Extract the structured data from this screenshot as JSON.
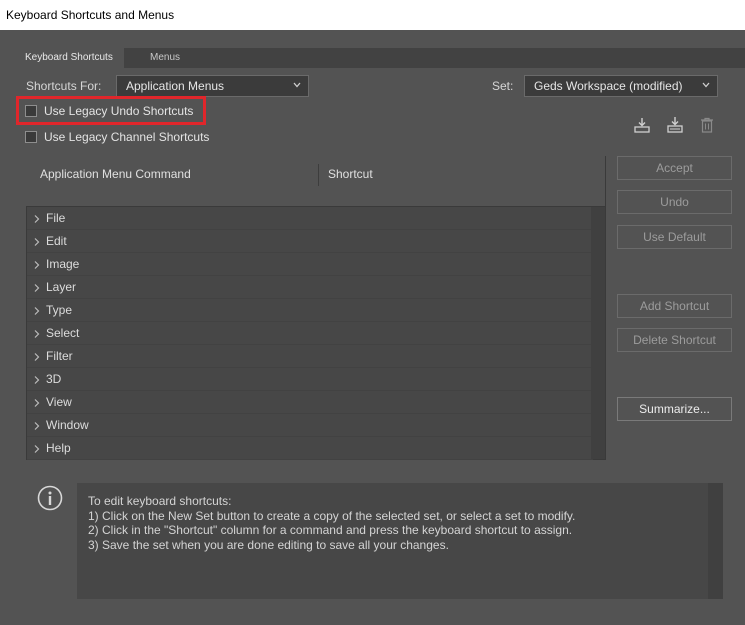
{
  "window": {
    "title": "Keyboard Shortcuts and Menus"
  },
  "tabs": [
    {
      "label": "Keyboard Shortcuts",
      "active": true
    },
    {
      "label": "Menus",
      "active": false
    }
  ],
  "shortcuts_for": {
    "label": "Shortcuts For:",
    "value": "Application Menus"
  },
  "set": {
    "label": "Set:",
    "value": "Geds Workspace (modified)"
  },
  "checkboxes": {
    "legacy_undo": {
      "label": "Use Legacy Undo Shortcuts",
      "checked": false
    },
    "legacy_channel": {
      "label": "Use Legacy Channel Shortcuts",
      "checked": false
    }
  },
  "set_icons": [
    "save-set-icon",
    "new-set-icon",
    "delete-set-icon"
  ],
  "table": {
    "col_command": "Application Menu Command",
    "col_shortcut": "Shortcut",
    "rows": [
      "File",
      "Edit",
      "Image",
      "Layer",
      "Type",
      "Select",
      "Filter",
      "3D",
      "View",
      "Window",
      "Help"
    ]
  },
  "buttons": {
    "accept": "Accept",
    "undo": "Undo",
    "use_default": "Use Default",
    "add_shortcut": "Add Shortcut",
    "delete_shortcut": "Delete Shortcut",
    "summarize": "Summarize..."
  },
  "info": {
    "icon": "info-icon",
    "lines": [
      "To edit keyboard shortcuts:",
      "1) Click on the New Set button to create a copy of the selected set, or select a set to modify.",
      "2) Click in the \"Shortcut\" column for a command and press the keyboard shortcut to assign.",
      "3) Save the set when you are done editing to save all your changes."
    ]
  },
  "colors": {
    "panel": "#535353",
    "highlight": "#e0262b"
  }
}
